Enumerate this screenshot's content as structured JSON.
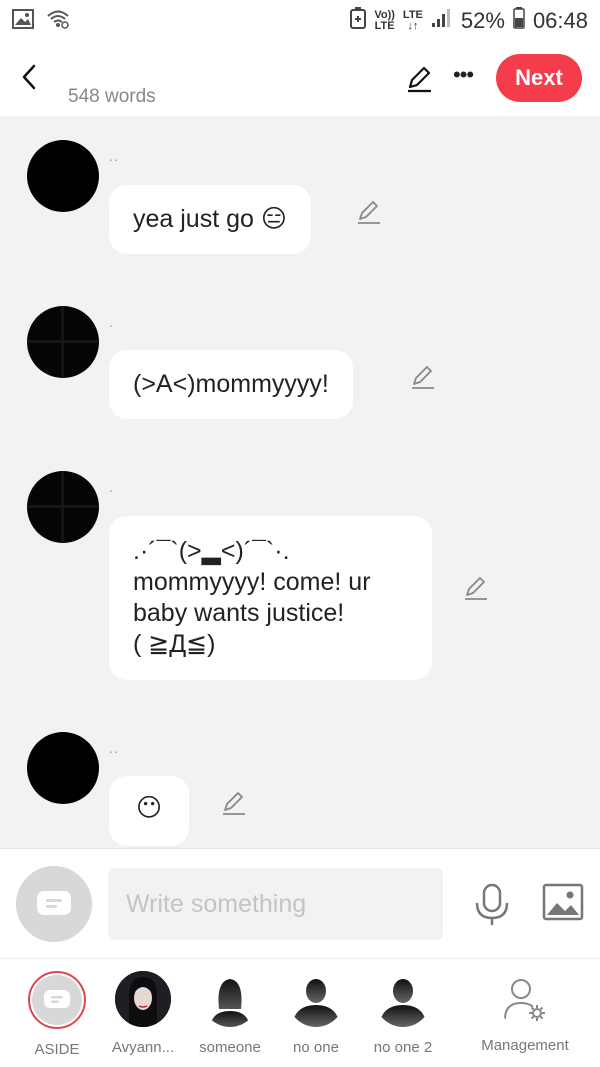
{
  "status_bar": {
    "net_top": "Vo))",
    "net_bottom": "LTE",
    "lte_top": "LTE",
    "lte_bottom": "↓↑",
    "battery": "52%",
    "time": "06:48"
  },
  "header": {
    "word_count": "548 words",
    "next_label": "Next"
  },
  "messages": [
    {
      "sender": "..",
      "text": "yea just go 😑"
    },
    {
      "sender": ".",
      "text": "(>A<)mommyyyy!"
    },
    {
      "sender": ".",
      "line1": ".·´¯`(>▂<)´¯`·.",
      "line2": "mommyyyy! come! ur",
      "line3": "baby wants justice!",
      "line4": "( ≧Д≦)"
    },
    {
      "sender": "..",
      "text": "😶"
    }
  ],
  "input": {
    "placeholder": "Write something"
  },
  "characters": [
    {
      "label": "ASIDE"
    },
    {
      "label": "Avyann..."
    },
    {
      "label": "someone"
    },
    {
      "label": "no one"
    },
    {
      "label": "no one 2"
    },
    {
      "label": "Management"
    }
  ],
  "colors": {
    "accent": "#f53c4a",
    "background": "#f2f2f2",
    "bubble": "#ffffff"
  }
}
